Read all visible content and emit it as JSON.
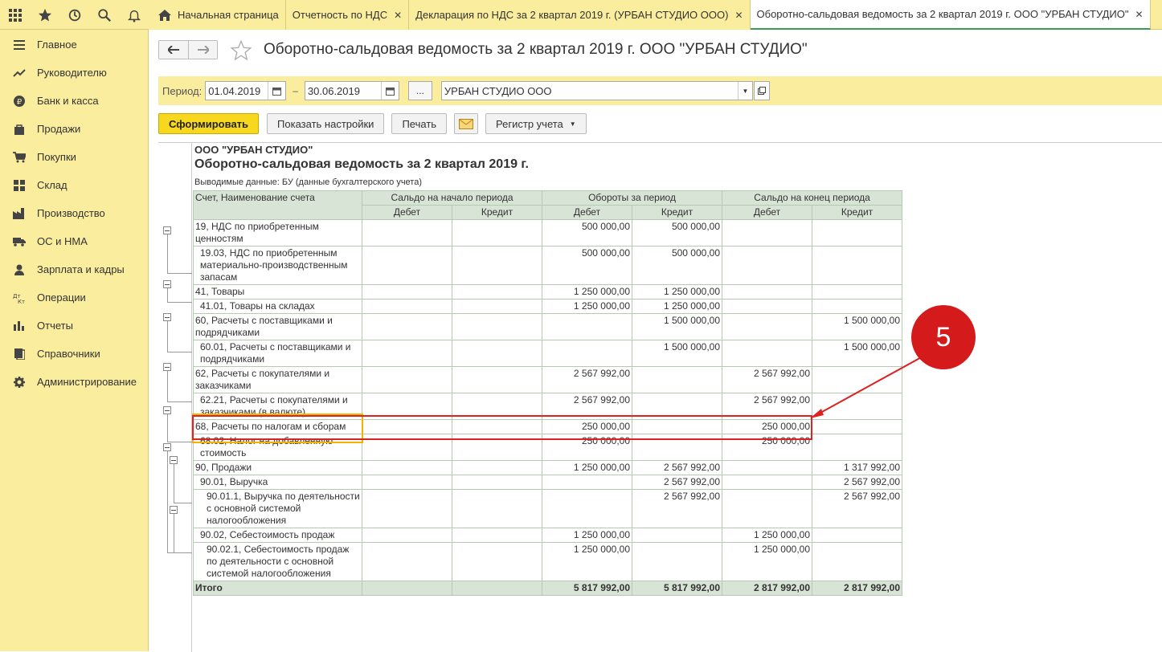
{
  "tabs": {
    "home": "Начальная страница",
    "t1": "Отчетность по НДС",
    "t2": "Декларация по НДС за 2 квартал 2019 г. (УРБАН СТУДИО ООО)",
    "t3": "Оборотно-сальдовая ведомость за 2 квартал 2019 г. ООО \"УРБАН СТУДИО\"",
    "close": "✕"
  },
  "sidebar": {
    "items": [
      {
        "label": "Главное",
        "icon": "menu-icon"
      },
      {
        "label": "Руководителю",
        "icon": "trend-icon"
      },
      {
        "label": "Банк и касса",
        "icon": "ruble-icon"
      },
      {
        "label": "Продажи",
        "icon": "bag-icon"
      },
      {
        "label": "Покупки",
        "icon": "cart-icon"
      },
      {
        "label": "Склад",
        "icon": "warehouse-icon"
      },
      {
        "label": "Производство",
        "icon": "factory-icon"
      },
      {
        "label": "ОС и НМА",
        "icon": "truck-icon"
      },
      {
        "label": "Зарплата и кадры",
        "icon": "person-icon"
      },
      {
        "label": "Операции",
        "icon": "dt-kt-icon"
      },
      {
        "label": "Отчеты",
        "icon": "bar-chart-icon"
      },
      {
        "label": "Справочники",
        "icon": "book-icon"
      },
      {
        "label": "Администрирование",
        "icon": "gear-icon"
      }
    ]
  },
  "header": {
    "title": "Оборотно-сальдовая ведомость за 2 квартал 2019 г. ООО \"УРБАН СТУДИО\""
  },
  "filters": {
    "period_label": "Период:",
    "date_from": "01.04.2019",
    "dash": "–",
    "date_to": "30.06.2019",
    "dots": "...",
    "organization": "УРБАН СТУДИО ООО"
  },
  "toolbar": {
    "generate": "Сформировать",
    "settings": "Показать настройки",
    "print": "Печать",
    "register": "Регистр учета"
  },
  "report": {
    "org": "ООО \"УРБАН СТУДИО\"",
    "title": "Оборотно-сальдовая ведомость за 2 квартал 2019 г.",
    "shown": "Выводимые данные:  БУ (данные бухгалтерского учета)",
    "headers": {
      "account": "Счет, Наименование счета",
      "start": "Сальдо на начало периода",
      "turnover": "Обороты за период",
      "end": "Сальдо на конец периода",
      "debit": "Дебет",
      "credit": "Кредит"
    },
    "rows": [
      {
        "name": "19, НДС по приобретенным ценностям",
        "c": [
          "",
          "",
          "500 000,00",
          "500 000,00",
          "",
          ""
        ]
      },
      {
        "name": "19.03, НДС по приобретенным материально-производственным запасам",
        "c": [
          "",
          "",
          "500 000,00",
          "500 000,00",
          "",
          ""
        ]
      },
      {
        "name": "41, Товары",
        "c": [
          "",
          "",
          "1 250 000,00",
          "1 250 000,00",
          "",
          ""
        ]
      },
      {
        "name": "41.01, Товары на складах",
        "c": [
          "",
          "",
          "1 250 000,00",
          "1 250 000,00",
          "",
          ""
        ]
      },
      {
        "name": "60, Расчеты с поставщиками и подрядчиками",
        "c": [
          "",
          "",
          "",
          "1 500 000,00",
          "",
          "1 500 000,00"
        ]
      },
      {
        "name": "60.01, Расчеты с поставщиками и подрядчиками",
        "c": [
          "",
          "",
          "",
          "1 500 000,00",
          "",
          "1 500 000,00"
        ]
      },
      {
        "name": "62, Расчеты с покупателями и заказчиками",
        "c": [
          "",
          "",
          "2 567 992,00",
          "",
          "2 567 992,00",
          ""
        ]
      },
      {
        "name": "62.21, Расчеты с покупателями и заказчиками (в валюте)",
        "c": [
          "",
          "",
          "2 567 992,00",
          "",
          "2 567 992,00",
          ""
        ]
      },
      {
        "name": "68, Расчеты по налогам и сборам",
        "c": [
          "",
          "",
          "250 000,00",
          "",
          "250 000,00",
          ""
        ]
      },
      {
        "name": "68.02, Налог на добавленную стоимость",
        "c": [
          "",
          "",
          "250 000,00",
          "",
          "250 000,00",
          ""
        ]
      },
      {
        "name": "90, Продажи",
        "c": [
          "",
          "",
          "1 250 000,00",
          "2 567 992,00",
          "",
          "1 317 992,00"
        ]
      },
      {
        "name": "90.01, Выручка",
        "c": [
          "",
          "",
          "",
          "2 567 992,00",
          "",
          "2 567 992,00"
        ]
      },
      {
        "name": "90.01.1, Выручка по деятельности с основной системой налогообложения",
        "c": [
          "",
          "",
          "",
          "2 567 992,00",
          "",
          "2 567 992,00"
        ]
      },
      {
        "name": "90.02, Себестоимость продаж",
        "c": [
          "",
          "",
          "1 250 000,00",
          "",
          "1 250 000,00",
          ""
        ]
      },
      {
        "name": "90.02.1, Себестоимость продаж по деятельности с основной системой налогообложения",
        "c": [
          "",
          "",
          "1 250 000,00",
          "",
          "1 250 000,00",
          ""
        ]
      }
    ],
    "total": {
      "name": "Итого",
      "c": [
        "",
        "",
        "5 817 992,00",
        "5 817 992,00",
        "2 817 992,00",
        "2 817 992,00"
      ]
    }
  },
  "annotation": {
    "badge": "5"
  },
  "colors": {
    "accent": "#f8d81f",
    "panel": "#fbed9e",
    "header_row": "#d8e4d5",
    "annotation": "#d41a1a"
  }
}
